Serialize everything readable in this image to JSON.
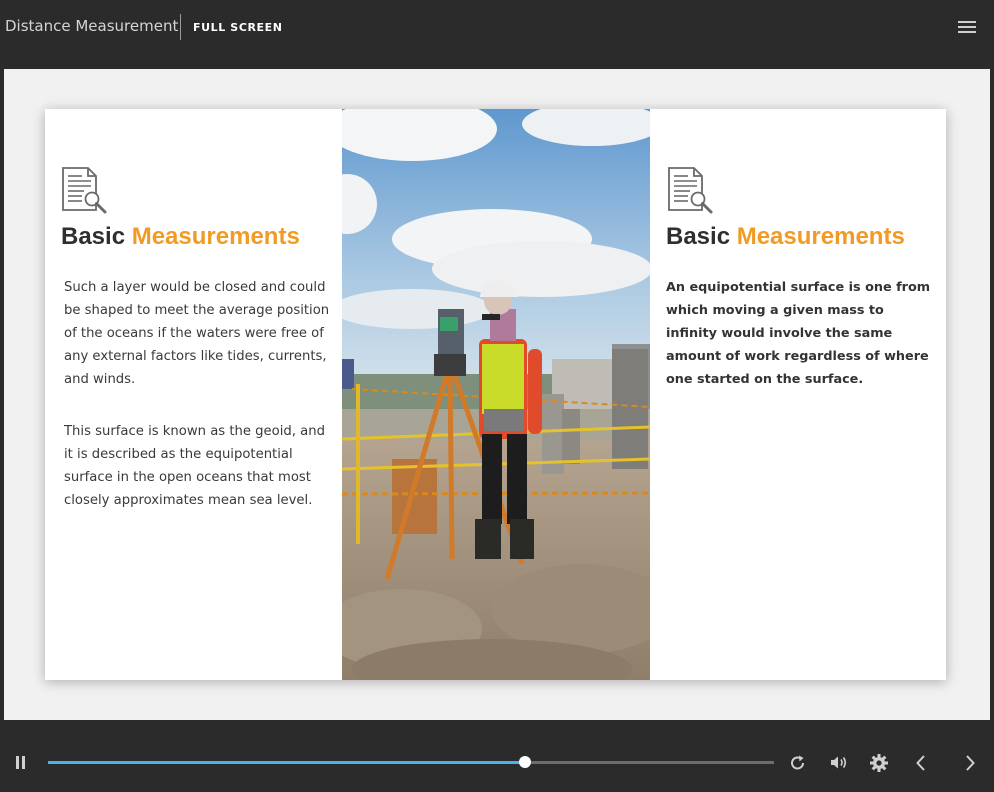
{
  "header": {
    "title": "Distance Measurement",
    "fullscreen_label": "FULL SCREEN",
    "menu_icon": "hamburger-menu-icon"
  },
  "slide": {
    "left": {
      "icon": "document-search-icon",
      "heading_plain": "Basic",
      "heading_accent": "Measurements",
      "paragraphs": [
        "Such a layer would be closed and could be shaped to meet the average position of the oceans if the waters were free of any external factors like tides, currents, and winds.",
        "This surface is known as the geoid, and it is described as the equipotential surface in the open oceans that most closely approximates mean sea level."
      ]
    },
    "photo": {
      "icon": "surveyor-photo"
    },
    "right": {
      "icon": "document-search-icon",
      "heading_plain": "Basic",
      "heading_accent": "Measurements",
      "paragraph": "An equipotential surface is one from which moving a given mass to infinity would involve the same amount of work regardless of where one started on the surface."
    }
  },
  "controls": {
    "play_state_icon": "pause-icon",
    "progress_fraction": 0.657,
    "icons": [
      "replay-icon",
      "volume-icon",
      "settings-gear-icon",
      "previous-arrow-icon",
      "next-arrow-icon"
    ]
  },
  "colors": {
    "accent": "#f29b24",
    "progress": "#4cb2ea",
    "chrome": "#2b2b2b"
  }
}
